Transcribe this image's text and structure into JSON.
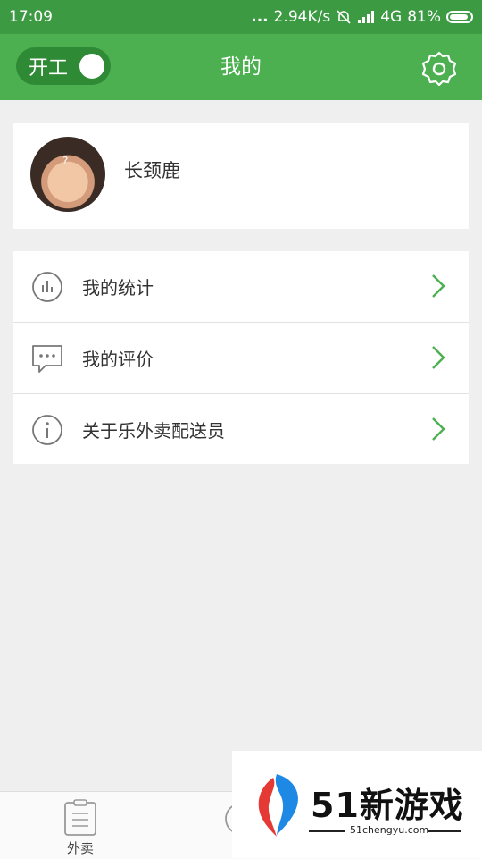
{
  "status_bar": {
    "time": "17:09",
    "dots": "...",
    "network_speed": "2.94K/s",
    "network_type": "4G",
    "battery": "81%"
  },
  "app_bar": {
    "toggle_label": "开工",
    "title": "我的",
    "settings_icon": "gear-icon"
  },
  "profile": {
    "name": "长颈鹿"
  },
  "menu": {
    "items": [
      {
        "label": "我的统计",
        "icon": "chart-icon"
      },
      {
        "label": "我的评价",
        "icon": "comment-icon"
      },
      {
        "label": "关于乐外卖配送员",
        "icon": "info-icon"
      }
    ]
  },
  "tab_bar": {
    "tabs": [
      {
        "label": "外卖",
        "icon": "clipboard-icon"
      },
      {
        "label": "",
        "icon": "clock-icon"
      }
    ]
  },
  "watermark": {
    "brand": "51新游戏",
    "site": "51chengyu.com"
  },
  "colors": {
    "status_bar": "#3c9a43",
    "app_bar": "#4caf50",
    "accent": "#4caf50",
    "background": "#efefef"
  }
}
